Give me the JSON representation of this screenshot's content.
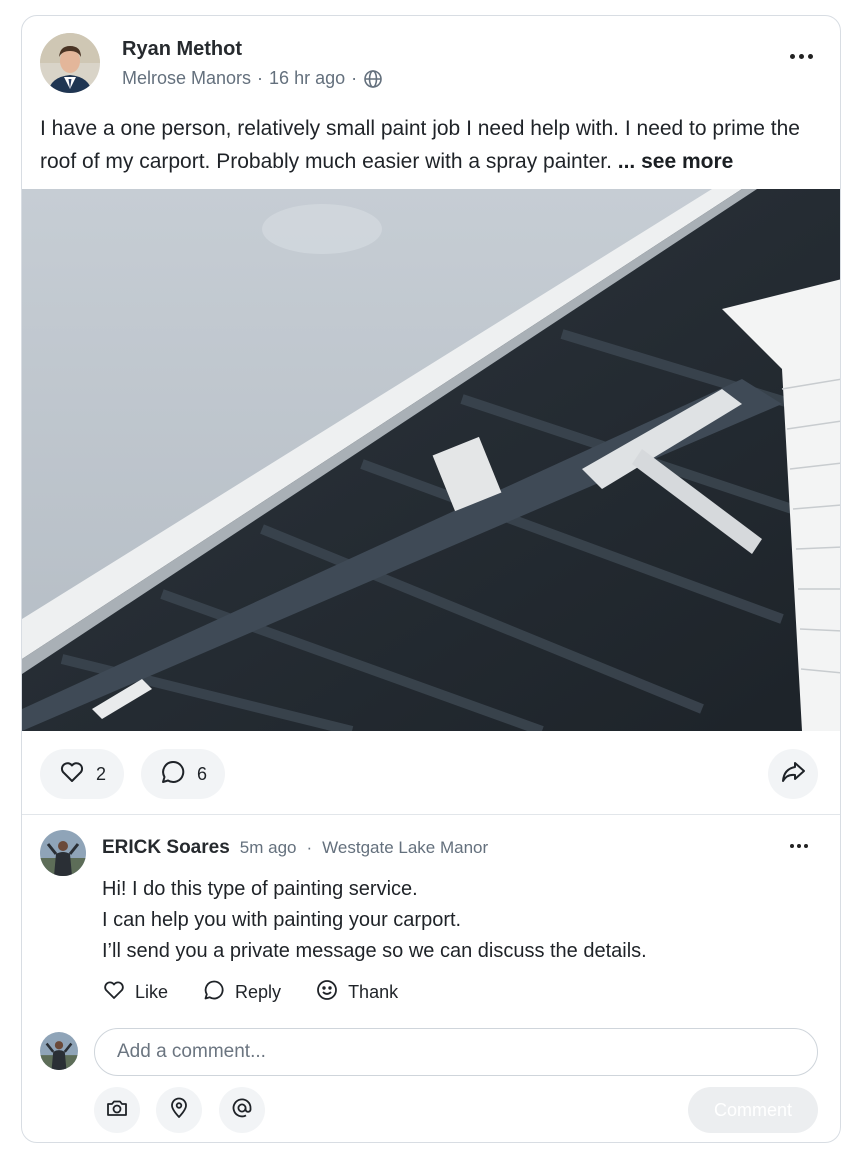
{
  "post": {
    "author": "Ryan Methot",
    "neighborhood": "Melrose Manors",
    "time": "16 hr ago",
    "separator": "·",
    "body": "I have a one person, relatively small paint job I need help with.  I need to prime the roof of my carport. Probably much easier with a spray painter. ",
    "see_more": "... see more",
    "photo_icon": "carport-photo",
    "likes": "2",
    "comments": "6"
  },
  "comment": {
    "author": "ERICK Soares",
    "time": "5m ago",
    "separator": "·",
    "neighborhood": "Westgate Lake Manor",
    "lines": [
      "Hi! I do this type of painting service.",
      "I can help you with painting your carport.",
      "I’ll send you a private message so we can discuss the details."
    ],
    "actions": {
      "like": "Like",
      "reply": "Reply",
      "thank": "Thank"
    }
  },
  "composer": {
    "placeholder": "Add a comment...",
    "submit": "Comment"
  },
  "colors": {
    "text": "#1f2328",
    "muted": "#64707d",
    "pill_bg": "#f2f4f6",
    "border": "#d8dde3"
  }
}
